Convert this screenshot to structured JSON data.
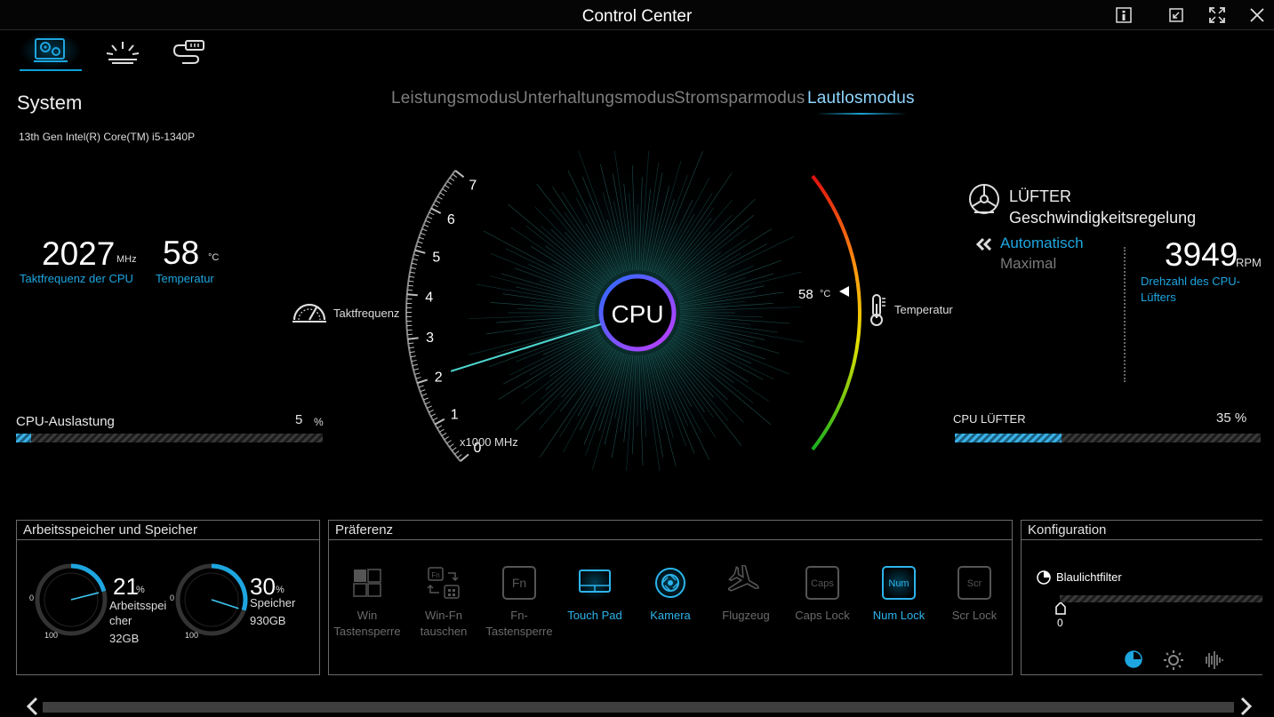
{
  "window": {
    "title": "Control Center",
    "buttons": [
      "info",
      "minimize",
      "maximize",
      "close"
    ]
  },
  "top_icons": [
    "system-settings-icon",
    "keyboard-light-icon",
    "cable-icon"
  ],
  "modes": {
    "items": [
      "Leistungsmodus",
      "Unterhaltungsmodus",
      "Stromsparmodus",
      "Lautlosmodus"
    ],
    "active": "Lautlosmodus"
  },
  "system": {
    "heading": "System",
    "cpu_name": "13th Gen Intel(R) Core(TM) i5-1340P",
    "freq_value": "2027",
    "freq_unit": "MHz",
    "freq_label": "Taktfrequenz der CPU",
    "temp_value": "58",
    "temp_unit": "°C",
    "temp_label": "Temperatur",
    "load_label": "CPU-Auslastung",
    "load_value": "5",
    "load_unit": "%",
    "load_percent": 5
  },
  "gauge": {
    "center_label": "CPU",
    "freq_label": "Taktfrequenz",
    "ticks": [
      "0",
      "1",
      "2",
      "3",
      "4",
      "5",
      "6",
      "7"
    ],
    "unit_label": "x1000 MHz",
    "freq_ghz": 2.027,
    "temp_readout": "58",
    "temp_readout_unit": "°C",
    "temp_label": "Temperatur",
    "temp_value": 58
  },
  "fan": {
    "title": "LÜFTER",
    "subtitle": "Geschwindigkeitsregelung",
    "mode_active": "Automatisch",
    "mode_other": "Maximal",
    "rpm_value": "3949",
    "rpm_unit": "RPM",
    "rpm_label": "Drehzahl des CPU-Lüfters",
    "bar_label": "CPU LÜFTER",
    "bar_value": "35 %",
    "bar_percent": 35
  },
  "memory": {
    "heading": "Arbeitsspeicher und Speicher",
    "ram": {
      "value": "21",
      "unit": "%",
      "label": "Arbeitsspeicher",
      "size": "32GB",
      "percent": 21,
      "min": "0",
      "max": "100"
    },
    "disk": {
      "value": "30",
      "unit": "%",
      "label": "Speicher",
      "size": "930GB",
      "percent": 30,
      "min": "0",
      "max": "100"
    }
  },
  "preference": {
    "heading": "Präferenz",
    "items": [
      {
        "label": "Win Tastensperre",
        "on": false
      },
      {
        "label": "Win-Fn tauschen",
        "on": false
      },
      {
        "label": "Fn-Tastensperre",
        "on": false
      },
      {
        "label": "Touch Pad",
        "on": true
      },
      {
        "label": "Kamera",
        "on": true
      },
      {
        "label": "Flugzeug",
        "on": false
      },
      {
        "label": "Caps Lock",
        "on": false
      },
      {
        "label": "Num Lock",
        "on": true
      },
      {
        "label": "Scr Lock",
        "on": false
      }
    ],
    "key_caps": {
      "fn": "Fn",
      "caps": "Caps",
      "num": "Num",
      "scr": "Scr"
    }
  },
  "config": {
    "heading": "Konfiguration",
    "bluelight_label": "Blaulichtfilter",
    "bluelight_value": "0",
    "bluelight_percent": 0
  }
}
